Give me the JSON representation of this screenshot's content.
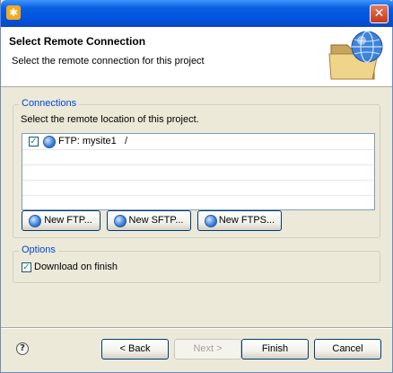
{
  "window": {
    "title": "",
    "close_glyph": "✕",
    "app_icon": "gear-icon"
  },
  "banner": {
    "title": "Select Remote Connection",
    "description": "Select the remote connection for this project",
    "icon": "folder-globe-icon"
  },
  "connections": {
    "legend": "Connections",
    "description": "Select the remote location of this project.",
    "items": [
      {
        "checked": true,
        "label": "FTP: mysite1   /"
      }
    ],
    "buttons": [
      "New FTP...",
      "New SFTP...",
      "New FTPS..."
    ]
  },
  "options": {
    "legend": "Options",
    "download_on_finish": {
      "checked": true,
      "label": "Download on finish"
    }
  },
  "footer": {
    "back": "< Back",
    "next": "Next >",
    "finish": "Finish",
    "cancel": "Cancel"
  },
  "colors": {
    "title_bar": "#0053dd",
    "group_legend": "#0046d5",
    "dialog_bg": "#ece9d8"
  }
}
